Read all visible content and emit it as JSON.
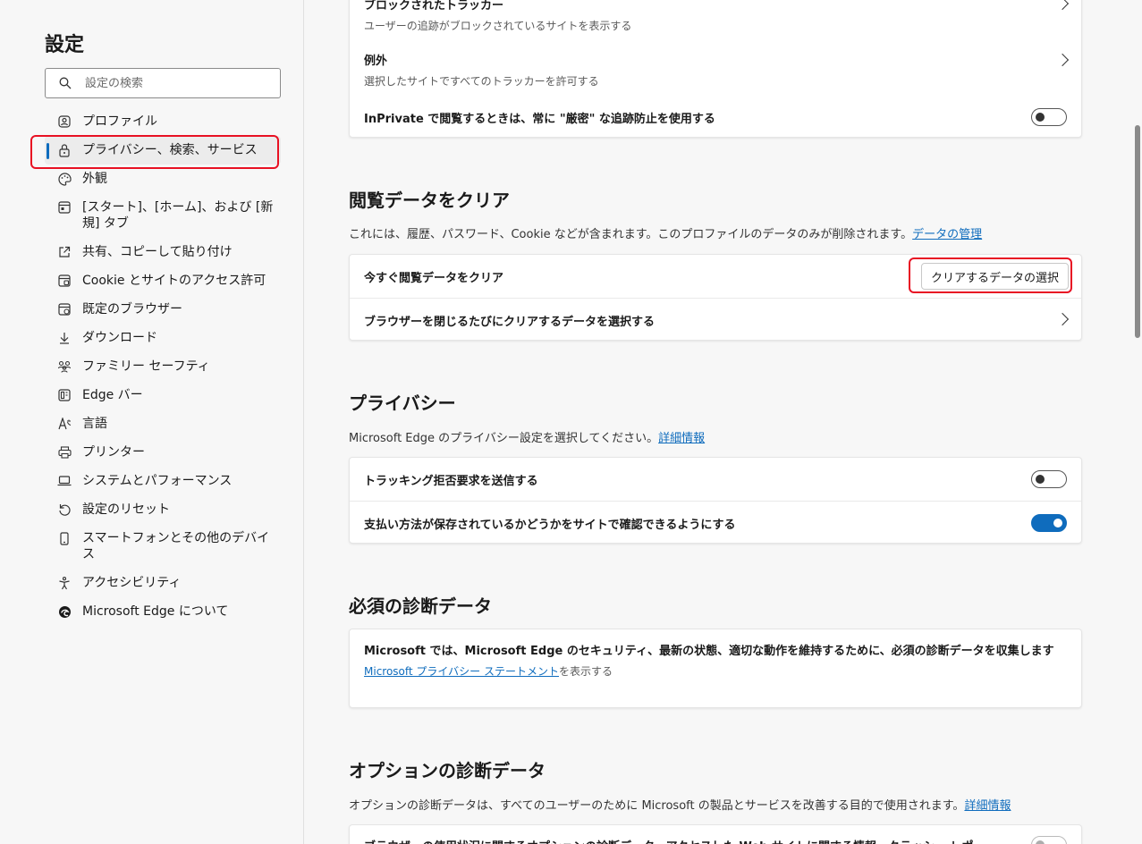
{
  "sidebar": {
    "title": "設定",
    "search_placeholder": "設定の検索",
    "items": [
      {
        "label": "プロファイル",
        "icon": "profile-icon"
      },
      {
        "label": "プライバシー、検索、サービス",
        "icon": "lock-icon",
        "active": true
      },
      {
        "label": "外観",
        "icon": "appearance-icon"
      },
      {
        "label": "[スタート]、[ホーム]、および [新規] タブ",
        "icon": "newtab-icon"
      },
      {
        "label": "共有、コピーして貼り付け",
        "icon": "share-icon"
      },
      {
        "label": "Cookie とサイトのアクセス許可",
        "icon": "site-permissions-icon"
      },
      {
        "label": "既定のブラウザー",
        "icon": "default-browser-icon"
      },
      {
        "label": "ダウンロード",
        "icon": "download-icon"
      },
      {
        "label": "ファミリー セーフティ",
        "icon": "family-icon"
      },
      {
        "label": "Edge バー",
        "icon": "edge-bar-icon"
      },
      {
        "label": "言語",
        "icon": "language-icon"
      },
      {
        "label": "プリンター",
        "icon": "printer-icon"
      },
      {
        "label": "システムとパフォーマンス",
        "icon": "laptop-icon"
      },
      {
        "label": "設定のリセット",
        "icon": "reset-icon"
      },
      {
        "label": "スマートフォンとその他のデバイス",
        "icon": "phone-icon"
      },
      {
        "label": "アクセシビリティ",
        "icon": "accessibility-icon"
      },
      {
        "label": "Microsoft Edge について",
        "icon": "edge-logo-icon"
      }
    ]
  },
  "tracking": {
    "blocked_title": "ブロックされたトラッカー",
    "blocked_desc": "ユーザーの追跡がブロックされているサイトを表示する",
    "exceptions_title": "例外",
    "exceptions_desc": "選択したサイトですべてのトラッカーを許可する",
    "inprivate_label": "InPrivate で閲覧するときは、常に \"厳密\" な追跡防止を使用する",
    "inprivate_on": false
  },
  "clear_data": {
    "heading": "閲覧データをクリア",
    "desc": "これには、履歴、パスワード、Cookie などが含まれます。このプロファイルのデータのみが削除されます。",
    "manage_link": "データの管理",
    "now_label": "今すぐ閲覧データをクリア",
    "choose_button": "クリアするデータの選択",
    "on_close_label": "ブラウザーを閉じるたびにクリアするデータを選択する"
  },
  "privacy": {
    "heading": "プライバシー",
    "desc": "Microsoft Edge のプライバシー設定を選択してください。",
    "learn_more": "詳細情報",
    "dnt_label": "トラッキング拒否要求を送信する",
    "dnt_on": false,
    "payment_label": "支払い方法が保存されているかどうかをサイトで確認できるようにする",
    "payment_on": true
  },
  "required_diag": {
    "heading": "必須の診断データ",
    "text": "Microsoft では、Microsoft Edge のセキュリティ、最新の状態、適切な動作を維持するために、必須の診断データを収集します",
    "link": "Microsoft プライバシー ステートメント",
    "link_suffix": "を表示する"
  },
  "optional_diag": {
    "heading": "オプションの診断データ",
    "desc": "オプションの診断データは、すべてのユーザーのために Microsoft の製品とサービスを改善する目的で使用されます。",
    "learn_more": "詳細情報",
    "row_label": "ブラウザーの使用状況に関するオプションの診断データ、アクセスした Web サイトに関する情報、クラッシュ レポ"
  },
  "colors": {
    "accent": "#0f6cbd",
    "highlight": "#e81123"
  }
}
